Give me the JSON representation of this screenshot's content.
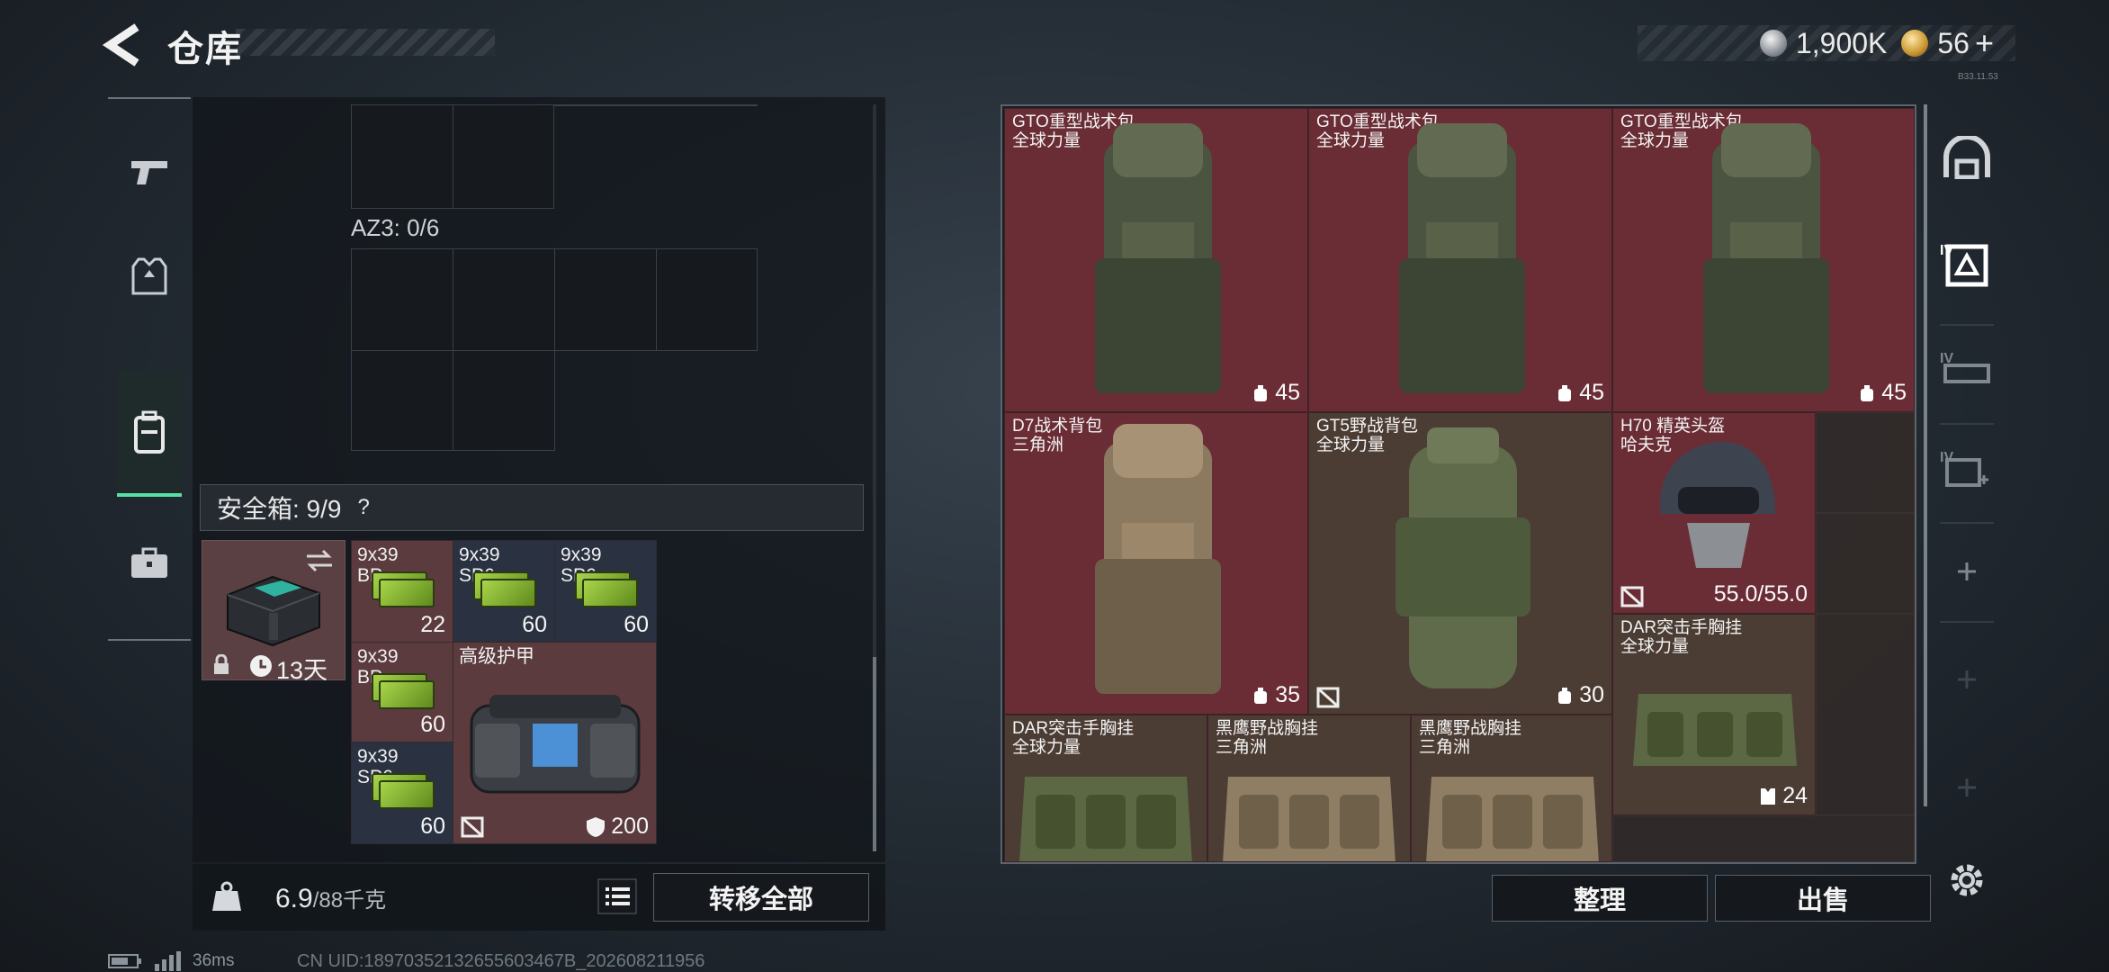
{
  "header": {
    "title": "仓库",
    "currency_silver": "1,900K",
    "currency_gold": "56",
    "gold_plus": "+",
    "version_tag": "B33.11.53"
  },
  "left_panel": {
    "az3_label": "AZ3: 0/6",
    "safebox_label": "安全箱: 9/9",
    "safebox_help": "?",
    "safebox_timer": "13天",
    "items": [
      {
        "name": "9x39\nBP",
        "qty": "22"
      },
      {
        "name": "9x39\nSP6",
        "qty": "60"
      },
      {
        "name": "9x39\nSP6",
        "qty": "60"
      },
      {
        "name": "9x39\nBP",
        "qty": "60"
      },
      {
        "name": "高级护甲",
        "qty": "200"
      },
      {
        "name": "9x39\nSP6",
        "qty": "60"
      }
    ],
    "weight_current": "6.9",
    "weight_max": "/88千克",
    "transfer_all_label": "转移全部"
  },
  "right_panel": {
    "cells": [
      {
        "name": "GTO重型战术包\n全球力量",
        "tag": "45"
      },
      {
        "name": "GTO重型战术包\n全球力量",
        "tag": "45"
      },
      {
        "name": "GTO重型战术包\n全球力量",
        "tag": "45"
      },
      {
        "name": "D7战术背包\n三角洲",
        "tag": "35"
      },
      {
        "name": "GT5野战背包\n全球力量",
        "tag": "30"
      },
      {
        "name": "H70 精英头盔\n哈夫克",
        "tag": "55.0/55.0"
      },
      {
        "name": "DAR突击手胸挂\n全球力量",
        "tag": "24"
      },
      {
        "name": "DAR突击手胸挂\n全球力量",
        "tag": ""
      },
      {
        "name": "黑鹰野战胸挂\n三角洲",
        "tag": ""
      },
      {
        "name": "黑鹰野战胸挂\n三角洲",
        "tag": ""
      }
    ],
    "rail_tier_labels": [
      "IV",
      "IV",
      "IV"
    ],
    "sort_label": "整理",
    "sell_label": "出售"
  },
  "status_bar": {
    "ping": "36ms",
    "uid": "CN UID:18970352132655603467B_202608211956"
  },
  "colors": {
    "accent_green": "#57e0a5",
    "cell_red": "#6a2d35",
    "cell_brown": "#4c3d34"
  }
}
